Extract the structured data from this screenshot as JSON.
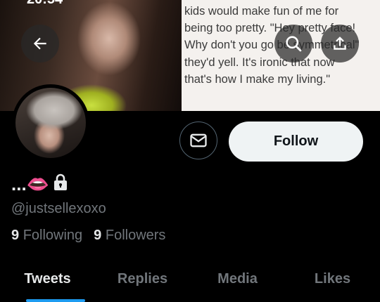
{
  "status_bar": {
    "time": "20:54"
  },
  "banner": {
    "quote_lines": "kids would make fun of me for\nbeing too pretty. \"Hey pretty face!\nWhy don't you go be symmetrical\"\nthey'd yell. It's ironic that now\nthat's how I make my living.\""
  },
  "header": {
    "back_icon": "arrow-left-icon",
    "search_icon": "search-icon",
    "share_icon": "share-icon"
  },
  "profile": {
    "display_name": "...👄",
    "handle": "@justsellexoxo",
    "protected_icon": "lock-icon",
    "following_count": "9",
    "following_label": "Following",
    "followers_count": "9",
    "followers_label": "Followers"
  },
  "actions": {
    "message_icon": "mail-icon",
    "follow_label": "Follow"
  },
  "tabs": [
    {
      "label": "Tweets",
      "active": true
    },
    {
      "label": "Replies",
      "active": false
    },
    {
      "label": "Media",
      "active": false
    },
    {
      "label": "Likes",
      "active": false
    }
  ],
  "colors": {
    "accent": "#1d9bf0",
    "background": "#000000",
    "muted_text": "#71767b"
  }
}
